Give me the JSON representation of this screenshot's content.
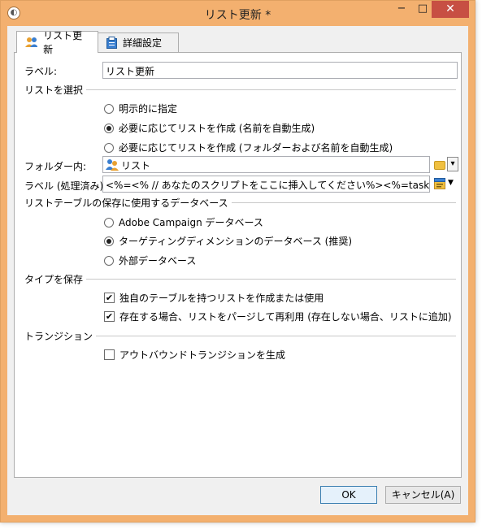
{
  "window": {
    "title": "リスト更新 *",
    "minimize": "−",
    "maximize": "□",
    "close": "✕"
  },
  "tabs": [
    {
      "label": "リスト更新",
      "icon": "users-icon"
    },
    {
      "label": "詳細設定",
      "icon": "clipboard-icon"
    }
  ],
  "form": {
    "label_field": {
      "label": "ラベル:",
      "value": "リスト更新"
    },
    "select_list": {
      "heading": "リストを選択",
      "options": [
        {
          "label": "明示的に指定",
          "selected": false
        },
        {
          "label": "必要に応じてリストを作成 (名前を自動生成)",
          "selected": true
        },
        {
          "label": "必要に応じてリストを作成 (フォルダーおよび名前を自動生成)",
          "selected": false
        }
      ]
    },
    "folder": {
      "label": "フォルダー内:",
      "value": "リスト"
    },
    "processed_label": {
      "label": "ラベル (処理済み):",
      "value": "<%=<% // あなたのスクリプトをここに挿入してください%><%=task.status%>"
    },
    "storage": {
      "heading": "リストテーブルの保存に使用するデータベース",
      "options": [
        {
          "label": "Adobe Campaign データベース",
          "selected": false
        },
        {
          "label": "ターゲティングディメンションのデータベース (推奨)",
          "selected": true
        },
        {
          "label": "外部データベース",
          "selected": false
        }
      ]
    },
    "save_type": {
      "heading": "タイプを保存",
      "options": [
        {
          "label": "独自のテーブルを持つリストを作成または使用",
          "checked": true
        },
        {
          "label": "存在する場合、リストをパージして再利用 (存在しない場合、リストに追加)",
          "checked": true
        }
      ]
    },
    "transition": {
      "heading": "トランジション",
      "options": [
        {
          "label": "アウトバウンドトランジションを生成",
          "checked": false
        }
      ]
    }
  },
  "buttons": {
    "ok": "OK",
    "cancel": "キャンセル(A)"
  },
  "colors": {
    "frame": "#f3b06f",
    "close": "#c74f43",
    "panel": "#ffffff",
    "dialog": "#f0f0f0"
  }
}
